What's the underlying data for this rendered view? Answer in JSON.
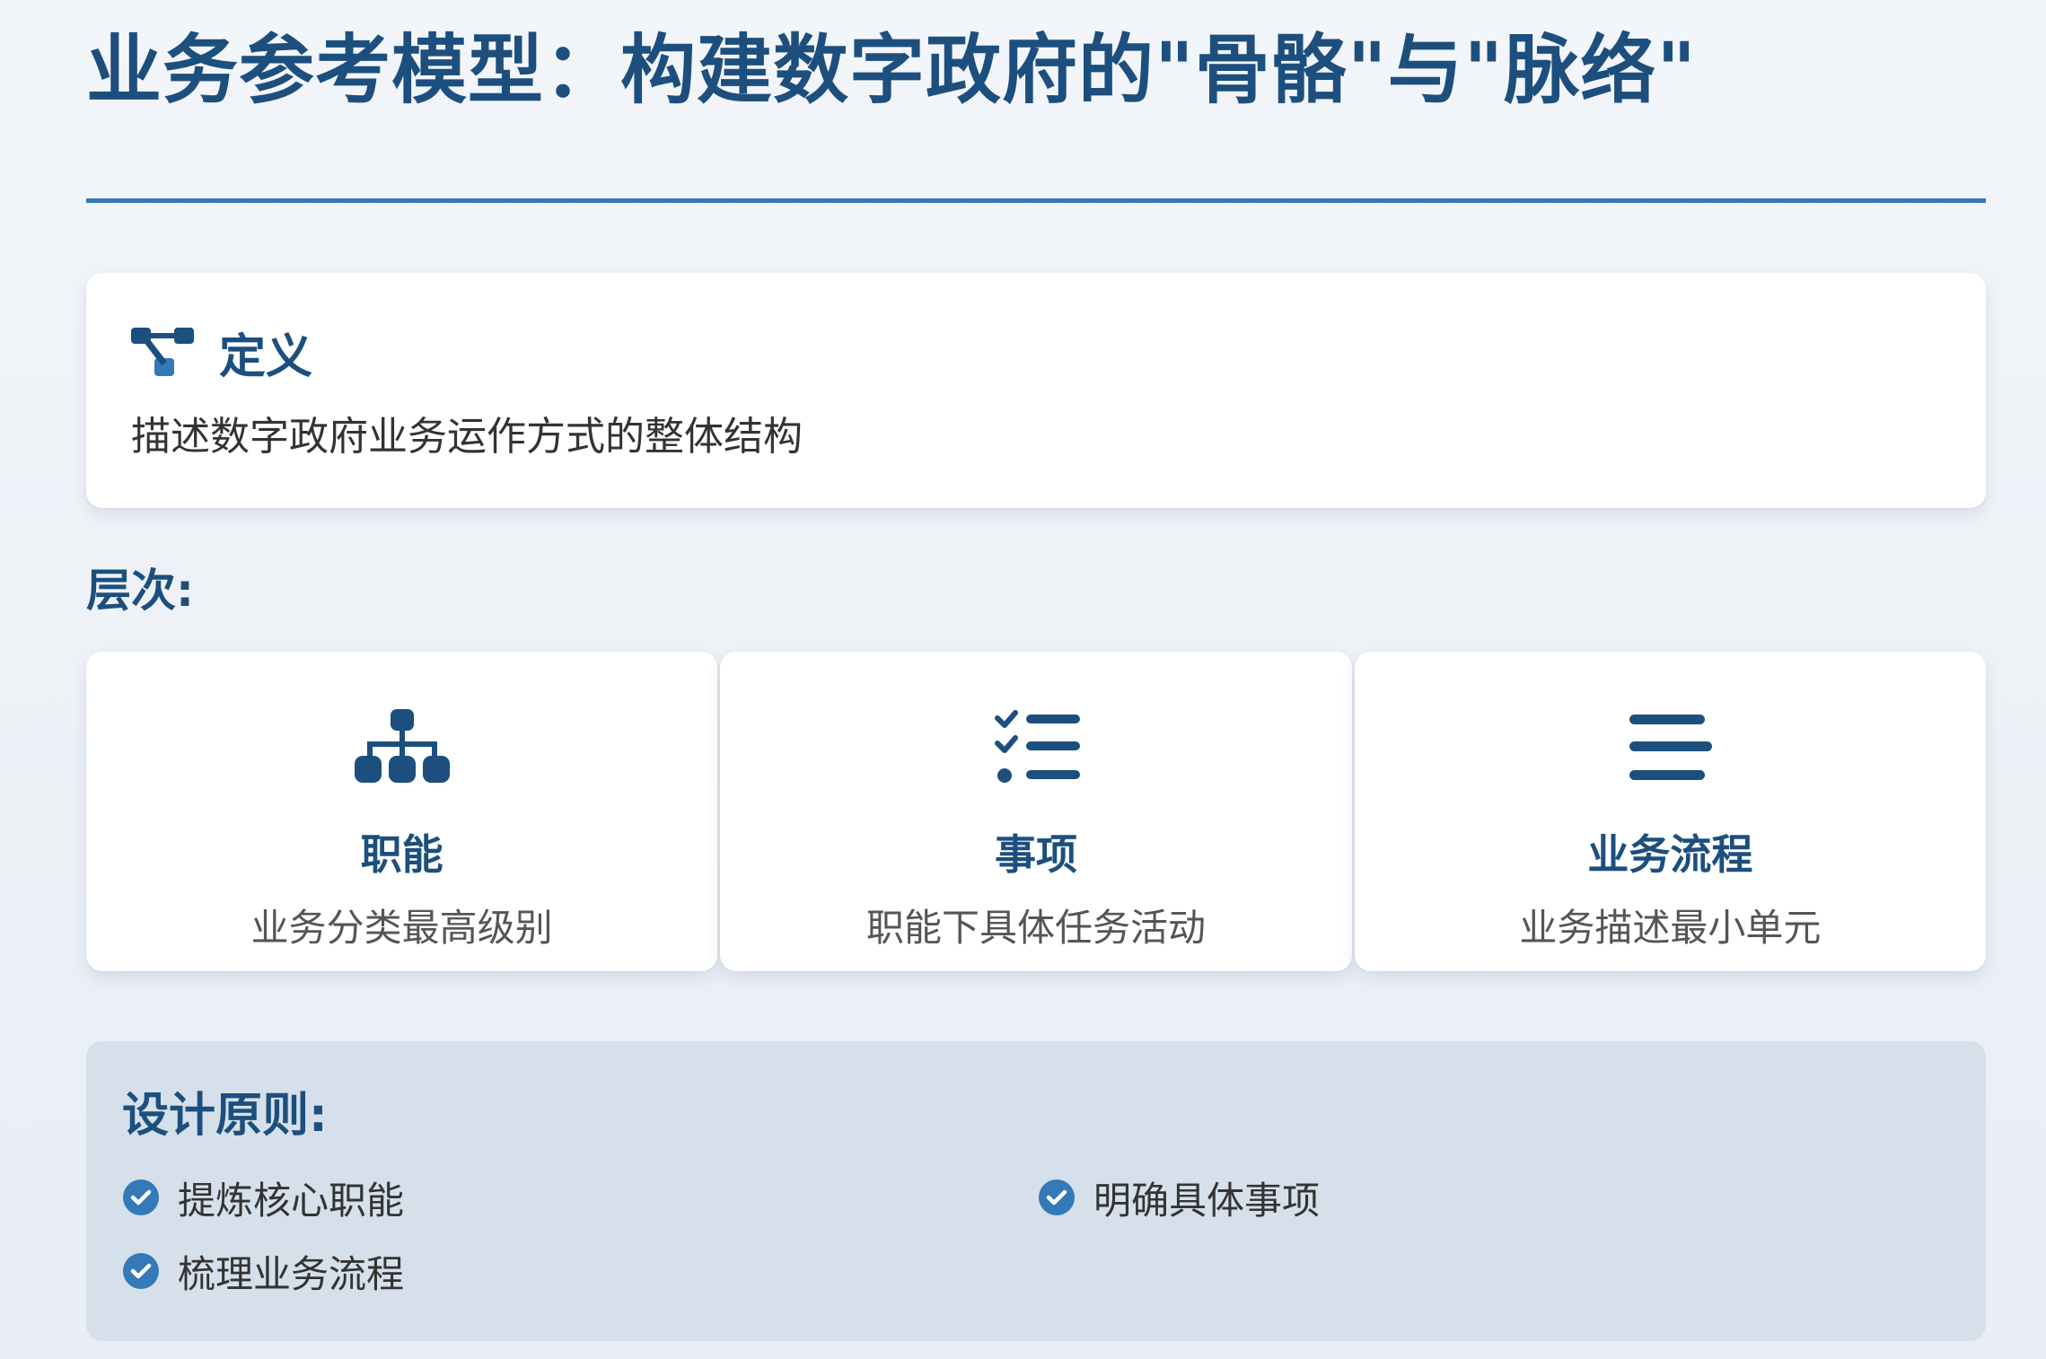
{
  "page": {
    "title": "业务参考模型：构建数字政府的\"骨骼\"与\"脉络\""
  },
  "definition": {
    "icon": "network-nodes-icon",
    "title": "定义",
    "text": "描述数字政府业务运作方式的整体结构"
  },
  "levels": {
    "label": "层次:",
    "items": [
      {
        "icon": "org-chart-icon",
        "name": "职能",
        "desc": "业务分类最高级别"
      },
      {
        "icon": "checklist-icon",
        "name": "事项",
        "desc": "职能下具体任务活动"
      },
      {
        "icon": "bars-icon",
        "name": "业务流程",
        "desc": "业务描述最小单元"
      }
    ]
  },
  "principles": {
    "title": "设计原则:",
    "icon": "check-circle-icon",
    "items": [
      "提炼核心职能",
      "明确具体事项",
      "梳理业务流程"
    ]
  },
  "colors": {
    "primary": "#1d4f7e",
    "accent": "#3479b8",
    "panel": "#d5e0ea"
  }
}
